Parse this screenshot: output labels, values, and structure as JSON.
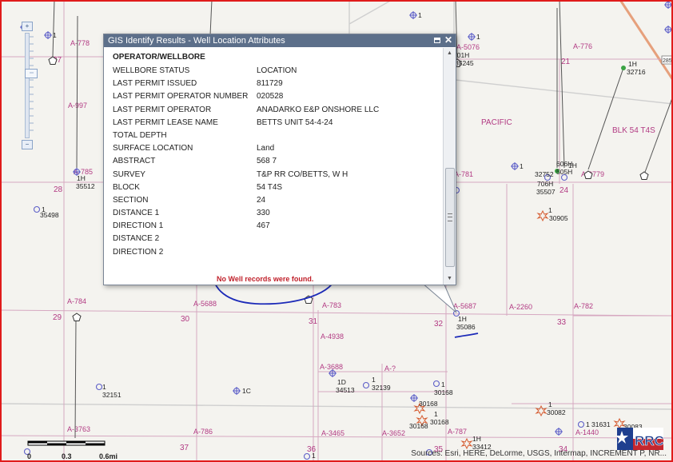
{
  "popup": {
    "title": "GIS Identify Results - Well Location Attributes",
    "maximize_glyph": "",
    "close_glyph": "✕",
    "heading": "OPERATOR/WELLBORE",
    "attributes": [
      {
        "key": "WELLBORE STATUS",
        "value": "LOCATION"
      },
      {
        "key": "LAST PERMIT ISSUED",
        "value": "811729"
      },
      {
        "key": "LAST PERMIT OPERATOR NUMBER",
        "value": "020528"
      },
      {
        "key": "LAST PERMIT OPERATOR",
        "value": "ANADARKO E&P ONSHORE LLC"
      },
      {
        "key": "LAST PERMIT LEASE NAME",
        "value": "BETTS UNIT 54-4-24"
      },
      {
        "key": "TOTAL DEPTH",
        "value": ""
      },
      {
        "key": "SURFACE LOCATION",
        "value": "Land"
      },
      {
        "key": "ABSTRACT",
        "value": "568 7"
      },
      {
        "key": "SURVEY",
        "value": "T&P RR CO/BETTS, W H"
      },
      {
        "key": "BLOCK",
        "value": "54 T4S"
      },
      {
        "key": "SECTION",
        "value": "24"
      },
      {
        "key": "DISTANCE 1",
        "value": "330"
      },
      {
        "key": "DIRECTION 1",
        "value": "467"
      },
      {
        "key": "DISTANCE 2",
        "value": ""
      },
      {
        "key": "DIRECTION 2",
        "value": ""
      }
    ],
    "message": "No Well records were found."
  },
  "map": {
    "colors": {
      "survey_line": "#d9a8c3",
      "label_pink": "#b23a83",
      "label_black": "#222222",
      "road": "#c9c9c9",
      "highway": "#e8a37e",
      "well_blue": "#5d5fc8",
      "annotation_blue": "#1c2ab8"
    },
    "labels": {
      "abstracts": [
        "A-778",
        "A-997",
        "A-785",
        "A-784",
        "A-5688",
        "A-783",
        "A-5687",
        "A-2260",
        "A-782",
        "A-4938",
        "A-3688",
        "A-?",
        "A-3465",
        "A-3652",
        "A-787",
        "A-1440",
        "A-786",
        "A-3763",
        "A-5076",
        "A-776",
        "A-3779",
        "A-781"
      ],
      "sections": [
        "37",
        "28",
        "29",
        "30",
        "31",
        "32",
        "33",
        "21",
        "24",
        "35",
        "36",
        "37",
        "34"
      ],
      "areas": [
        "PACIFIC",
        "BLK 54 T4S"
      ],
      "wells": [
        "1",
        "1H",
        "35512",
        "1",
        "35498",
        "1",
        "32151",
        "1C",
        "1D",
        "34513",
        "1",
        "32139",
        "1",
        "30168",
        "30168",
        "30168",
        "30168",
        "1",
        "30082",
        "1",
        "31631",
        "1H",
        "33412",
        "1H",
        "35086",
        "1",
        "30905",
        "1H",
        "32752",
        "606H",
        "505H",
        "706H",
        "35507",
        "1H",
        "32716",
        "701H",
        "35245",
        "1",
        "1",
        "1",
        "1",
        "1"
      ],
      "highway": "285"
    }
  },
  "scale": {
    "labels": [
      "0",
      "0.3",
      "0.6mi"
    ]
  },
  "attribution": "Sources: Esri, HERE, DeLorme, USGS, Intermap, INCREMENT P, NR...",
  "logo": {
    "text": "RRC",
    "colors": [
      "#c4262e",
      "#1f3f8f",
      "#ffffff"
    ]
  },
  "zoom": {
    "in_glyph": "+",
    "out_glyph": "−"
  }
}
